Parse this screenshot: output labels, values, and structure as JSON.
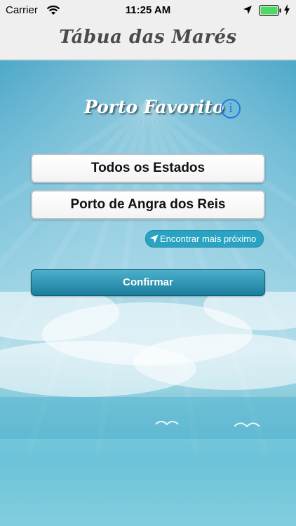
{
  "status_bar": {
    "carrier": "Carrier",
    "time": "11:25 AM",
    "icons": [
      "wifi-icon",
      "location-arrow-icon",
      "battery-icon",
      "charging-bolt-icon"
    ],
    "battery_color": "#4cd964"
  },
  "nav": {
    "title": "Tábua das Marés"
  },
  "main": {
    "title": "Porto Favorito",
    "info_icon": "info-icon",
    "state_picker": "Todos os Estados",
    "port_picker": "Porto de Angra dos Reis",
    "nearest_button": "Encontrar mais próximo",
    "confirm_button": "Confirmar"
  },
  "colors": {
    "accent": "#1f7ae0",
    "button": "#1a7d9c",
    "nearest_button": "#2aa3c2"
  }
}
